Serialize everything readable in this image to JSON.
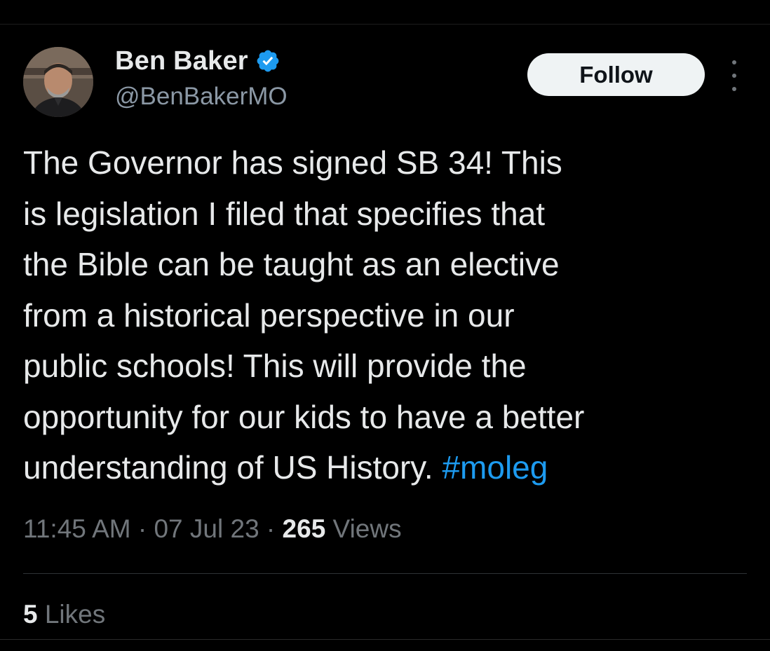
{
  "author": {
    "display_name": "Ben Baker",
    "handle": "@BenBakerMO",
    "verified": true,
    "avatar_icon": "profile-photo"
  },
  "actions": {
    "follow_label": "Follow",
    "more_icon": "more-vertical-icon"
  },
  "tweet": {
    "lines": [
      "The Governor has signed SB 34! This",
      "is legislation I filed that specifies that",
      "the Bible can be taught as an elective",
      "from a historical perspective in our",
      "public schools! This will provide the",
      "opportunity for our kids to have a better",
      "understanding of US History. "
    ],
    "hashtag": "#moleg"
  },
  "meta": {
    "time": "11:45 AM",
    "separator": " · ",
    "date": "07 Jul 23",
    "views_count": "265",
    "views_label": " Views"
  },
  "engagement": {
    "likes_count": "5",
    "likes_label": " Likes"
  },
  "colors": {
    "background": "#000000",
    "text_primary": "#e7e9ea",
    "text_secondary": "#71767b",
    "link": "#1d9bf0",
    "verified_badge": "#1d9bf0",
    "follow_button_bg": "#eff3f4"
  }
}
